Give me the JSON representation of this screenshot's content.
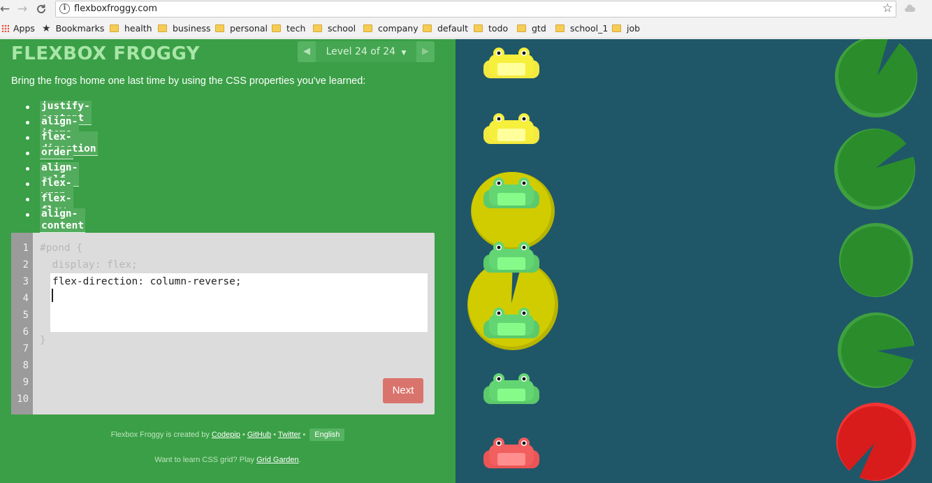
{
  "browser": {
    "url": "flexboxfroggy.com",
    "bookmarks": [
      {
        "label": "Apps",
        "type": "apps"
      },
      {
        "label": "Bookmarks",
        "type": "star"
      },
      {
        "label": "health",
        "type": "folder"
      },
      {
        "label": "business",
        "type": "folder"
      },
      {
        "label": "personal",
        "type": "folder"
      },
      {
        "label": "tech",
        "type": "folder"
      },
      {
        "label": "school",
        "type": "folder"
      },
      {
        "label": "company",
        "type": "folder"
      },
      {
        "label": "default",
        "type": "folder"
      },
      {
        "label": "todo",
        "type": "folder"
      },
      {
        "label": "gtd",
        "type": "folder"
      },
      {
        "label": "school_1",
        "type": "folder"
      },
      {
        "label": "job",
        "type": "folder"
      }
    ]
  },
  "game": {
    "logo": "FLEXBOX FROGGY",
    "level_label": "Level 24 of 24",
    "instructions": "Bring the frogs home one last time by using the CSS properties you've learned:",
    "properties": [
      "justify-content",
      "align-items",
      "flex-direction",
      "order",
      "align-self",
      "flex-wrap",
      "flex-flow",
      "align-content"
    ],
    "editor": {
      "line_numbers": [
        "1",
        "2",
        "3",
        "4",
        "5",
        "6",
        "7",
        "8",
        "9",
        "10"
      ],
      "line1": "#pond {",
      "line2": "  display: flex;",
      "typed": "flex-direction: column-reverse;",
      "closing": "}"
    },
    "next_label": "Next"
  },
  "footer": {
    "created_prefix": "Flexbox Froggy is created by",
    "codepip": "Codepip",
    "github": "GitHub",
    "twitter": "Twitter",
    "separator": "•",
    "language": "English",
    "grid_prefix": "Want to learn CSS grid? Play",
    "grid_link": "Grid Garden",
    "grid_suffix": "."
  },
  "colors": {
    "panel_green": "#3a9f46",
    "pond_blue": "#1f5768",
    "frog_yellow": "#f3f03a",
    "frog_green": "#5dd46a",
    "frog_red": "#f05a5a",
    "pad_yellow": "#d4d000",
    "pad_green": "#2e8c2e",
    "pad_red": "#e02020"
  },
  "pond": {
    "frogs": [
      "yellow",
      "yellow",
      "green",
      "green",
      "green",
      "green",
      "red"
    ],
    "lilypads": [
      "yellow",
      "yellow",
      "green",
      "green",
      "green",
      "green",
      "red"
    ]
  }
}
